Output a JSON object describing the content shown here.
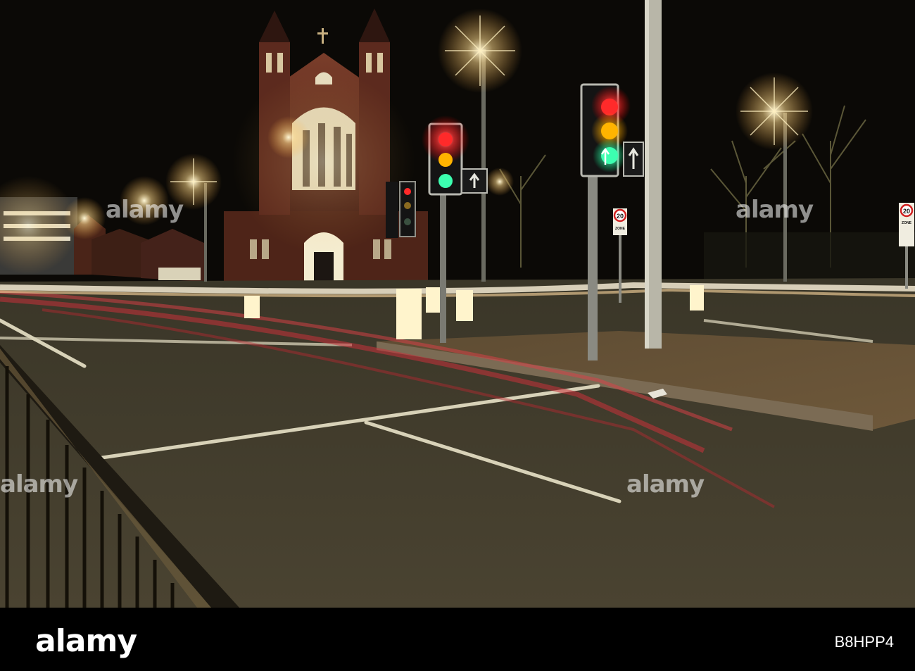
{
  "photo": {
    "scene": "Night street junction with lit church, traffic lights and light trails"
  },
  "signs": {
    "speed_limit_value": "20",
    "speed_limit_zone": "ZONE"
  },
  "watermark": {
    "text": "alamy",
    "footer_logo": "alamy",
    "image_id": "B8HPP4"
  },
  "colors": {
    "sky": "#0a0805",
    "road": "#3f3a2a",
    "church_brick": "#5a2a1e",
    "trail_red": "#c8323a",
    "trail_white": "#fff5dc",
    "signal_red": "#ff2a2a",
    "signal_amber": "#ffb400",
    "signal_green": "#3cffb0"
  }
}
